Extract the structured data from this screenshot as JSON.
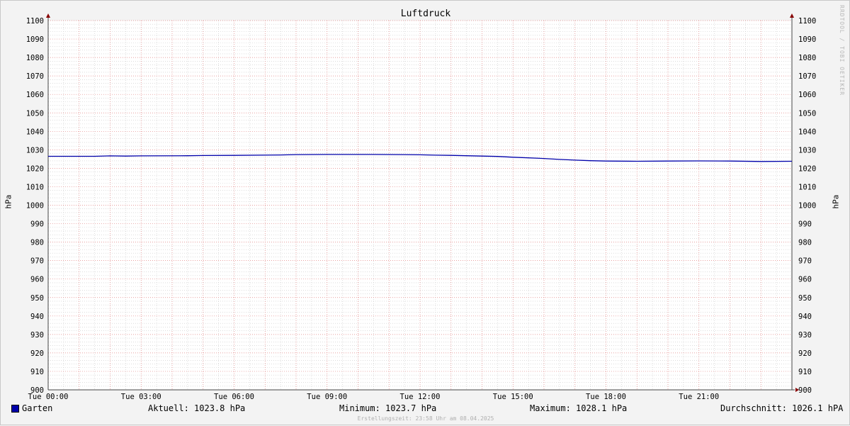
{
  "chart_data": {
    "type": "line",
    "title": "Luftdruck",
    "ylabel": "hPa",
    "ylim": [
      900,
      1100
    ],
    "y_ticks": [
      900,
      910,
      920,
      930,
      940,
      950,
      960,
      970,
      980,
      990,
      1000,
      1010,
      1020,
      1030,
      1040,
      1050,
      1060,
      1070,
      1080,
      1090,
      1100
    ],
    "x_range_hours": [
      0,
      24
    ],
    "x_ticks": [
      {
        "hour": 0,
        "label": "Tue 00:00"
      },
      {
        "hour": 3,
        "label": "Tue 03:00"
      },
      {
        "hour": 6,
        "label": "Tue 06:00"
      },
      {
        "hour": 9,
        "label": "Tue 09:00"
      },
      {
        "hour": 12,
        "label": "Tue 12:00"
      },
      {
        "hour": 15,
        "label": "Tue 15:00"
      },
      {
        "hour": 18,
        "label": "Tue 18:00"
      },
      {
        "hour": 21,
        "label": "Tue 21:00"
      }
    ],
    "grid": true,
    "series": [
      {
        "name": "Garten",
        "color": "#0000aa",
        "points": [
          [
            0,
            1026.5
          ],
          [
            1.5,
            1026.5
          ],
          [
            2.0,
            1026.7
          ],
          [
            2.5,
            1026.6
          ],
          [
            3.0,
            1026.7
          ],
          [
            4.5,
            1026.8
          ],
          [
            5.0,
            1026.9
          ],
          [
            6.0,
            1027.0
          ],
          [
            7.5,
            1027.2
          ],
          [
            8.0,
            1027.4
          ],
          [
            9.0,
            1027.5
          ],
          [
            10.5,
            1027.5
          ],
          [
            11.5,
            1027.4
          ],
          [
            12.0,
            1027.3
          ],
          [
            12.5,
            1027.1
          ],
          [
            13.0,
            1027.0
          ],
          [
            14.0,
            1026.6
          ],
          [
            14.5,
            1026.4
          ],
          [
            15.0,
            1026.0
          ],
          [
            16.0,
            1025.3
          ],
          [
            16.5,
            1024.8
          ],
          [
            17.0,
            1024.4
          ],
          [
            17.5,
            1024.1
          ],
          [
            18.0,
            1023.9
          ],
          [
            19.0,
            1023.8
          ],
          [
            20.0,
            1023.9
          ],
          [
            21.0,
            1024.0
          ],
          [
            22.0,
            1023.9
          ],
          [
            23.0,
            1023.7
          ],
          [
            24.0,
            1023.8
          ]
        ]
      }
    ]
  },
  "legend": {
    "series_name": "Garten",
    "current": "Aktuell: 1023.8 hPa",
    "minimum": "Minimum: 1023.7 hPa",
    "maximum": "Maximum: 1028.1 hPa",
    "average": "Durchschnitt: 1026.1 hPA"
  },
  "watermark": "RRDTOOL / TOBI OETIKER",
  "footer": "Erstellungszeit: 23:58 Uhr am 08.04.2025",
  "colors": {
    "line": "#0000aa",
    "major_grid": "#e08080",
    "minor_grid": "#c8c8c8",
    "background": "#f3f3f3",
    "plot_background": "#ffffff",
    "arrow": "#880000"
  }
}
